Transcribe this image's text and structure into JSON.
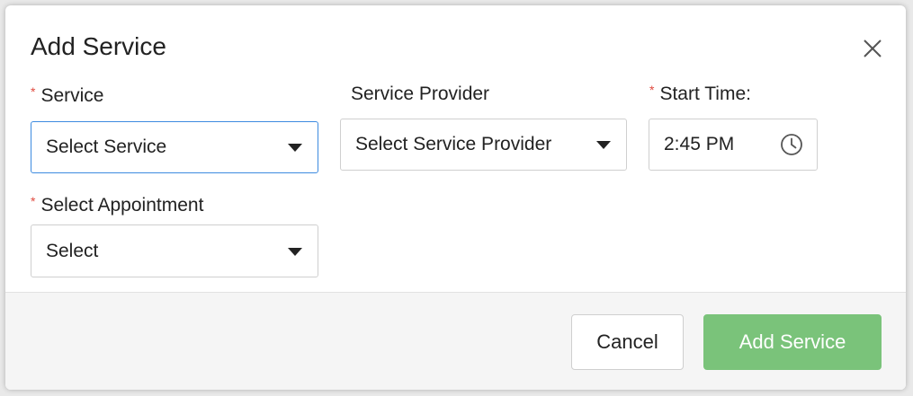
{
  "dialog": {
    "title": "Add Service",
    "close_icon": "close-icon"
  },
  "form": {
    "required_marker": "*",
    "service": {
      "label": "Service",
      "required": true,
      "value": "Select Service"
    },
    "service_provider": {
      "label": "Service Provider",
      "required": false,
      "value": "Select Service Provider"
    },
    "start_time": {
      "label": "Start Time:",
      "required": true,
      "value": "2:45 PM",
      "icon": "clock-icon"
    },
    "appointment": {
      "label": "Select Appointment",
      "required": true,
      "value": "Select"
    }
  },
  "footer": {
    "cancel_label": "Cancel",
    "add_label": "Add Service"
  },
  "colors": {
    "accent_green": "#7ac37a",
    "required_red": "#e04a3f",
    "focus_blue": "#3d8be0"
  }
}
